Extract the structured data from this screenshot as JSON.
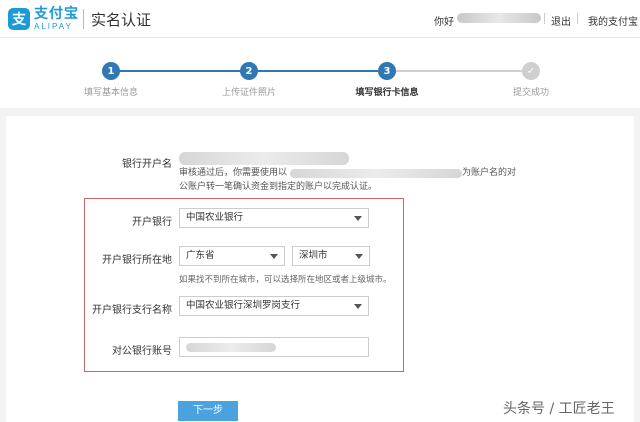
{
  "header": {
    "logo_glyph": "支",
    "logo_cn": "支付宝",
    "logo_en": "ALIPAY",
    "page_title": "实名认证",
    "greeting": "你好",
    "logout": "退出",
    "my_alipay": "我的支付宝"
  },
  "steps": [
    {
      "number": "1",
      "label": "填写基本信息",
      "state": "done"
    },
    {
      "number": "2",
      "label": "上传证件照片",
      "state": "done"
    },
    {
      "number": "3",
      "label": "填写银行卡信息",
      "state": "current"
    },
    {
      "number": "✓",
      "label": "提交成功",
      "state": "pending"
    }
  ],
  "form": {
    "account_name_label": "银行开户名",
    "note_line1_start": "审核通过后，你需要使用以",
    "note_line1_end": "为账户名的对",
    "note_line2": "公账户转一笔确认资金到指定的账户以完成认证。",
    "bank_label": "开户银行",
    "bank_value": "中国农业银行",
    "location_label": "开户银行所在地",
    "province_value": "广东省",
    "city_value": "深圳市",
    "location_hint": "如果找不到所在城市，可以选择所在地区或者上级城市。",
    "branch_label": "开户银行支行名称",
    "branch_value": "中国农业银行深圳罗岗支行",
    "account_label": "对公银行账号",
    "next_button": "下一步"
  },
  "watermark": "头条号 / 工匠老王",
  "colors": {
    "brand": "#1a9ad6",
    "step_active": "#2f78b4",
    "step_pending": "#cfcfcf",
    "button": "#4aa3df",
    "highlight_box": "#cc6666"
  }
}
